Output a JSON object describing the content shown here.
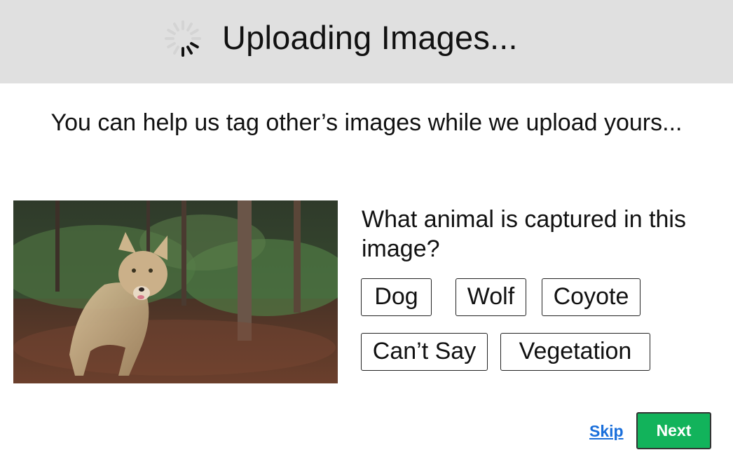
{
  "header": {
    "title": "Uploading Images...",
    "spinner_icon": "loading-spinner-icon",
    "background": "#e0e0e0"
  },
  "subtitle": "You can help us tag other’s images while we upload yours...",
  "task": {
    "image_icon": "coyote-in-forest-photo",
    "question": "What animal is captured in this image?",
    "options": [
      "Dog",
      "Wolf",
      "Coyote",
      "Can’t Say",
      "Vegetation"
    ]
  },
  "footer": {
    "skip_label": "Skip",
    "next_label": "Next",
    "next_color": "#12b35b",
    "skip_color": "#1a6fdb"
  }
}
